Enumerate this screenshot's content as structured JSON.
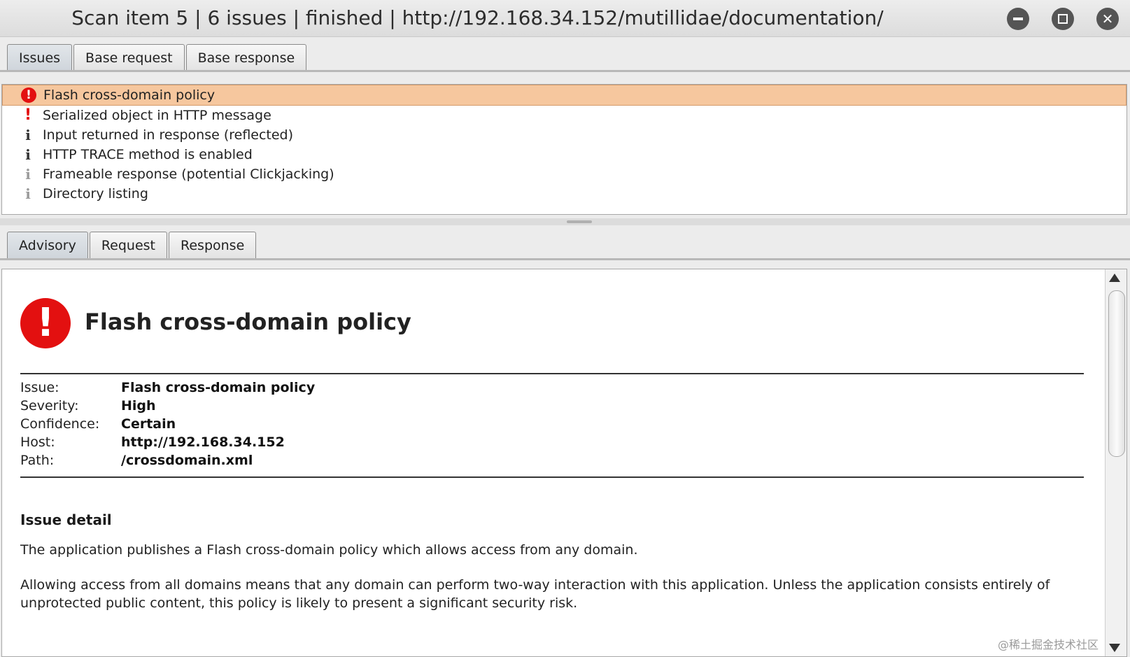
{
  "window": {
    "title": "Scan item 5 | 6 issues | finished | http://192.168.34.152/mutillidae/documentation/"
  },
  "top_tabs": [
    "Issues",
    "Base request",
    "Base response"
  ],
  "issues": [
    {
      "label": "Flash cross-domain policy",
      "icon": "high-severity-icon",
      "selected": true
    },
    {
      "label": "Serialized object in HTTP message",
      "icon": "exclamation-icon"
    },
    {
      "label": "Input returned in response (reflected)",
      "icon": "info-icon"
    },
    {
      "label": "HTTP TRACE method is enabled",
      "icon": "info-icon"
    },
    {
      "label": "Frameable response (potential Clickjacking)",
      "icon": "info-light-icon"
    },
    {
      "label": "Directory listing",
      "icon": "info-light-icon"
    }
  ],
  "bottom_tabs": [
    "Advisory",
    "Request",
    "Response"
  ],
  "advisory": {
    "title": "Flash cross-domain policy",
    "fields": [
      {
        "key": "Issue:",
        "value": "Flash cross-domain policy"
      },
      {
        "key": "Severity:",
        "value": "High"
      },
      {
        "key": "Confidence:",
        "value": "Certain"
      },
      {
        "key": "Host:",
        "value": "http://192.168.34.152"
      },
      {
        "key": "Path:",
        "value": "/crossdomain.xml"
      }
    ],
    "section_heading": "Issue detail",
    "paragraph1": "The application publishes a Flash cross-domain policy which allows access from any domain.",
    "paragraph2": "Allowing access from all domains means that any domain can perform two-way interaction with this application. Unless the application consists entirely of unprotected public content, this policy is likely to present a significant security risk."
  },
  "watermark": "@稀土掘金技术社区",
  "colors": {
    "selected_row": "#f6c79e",
    "severity_high": "#e31010"
  }
}
